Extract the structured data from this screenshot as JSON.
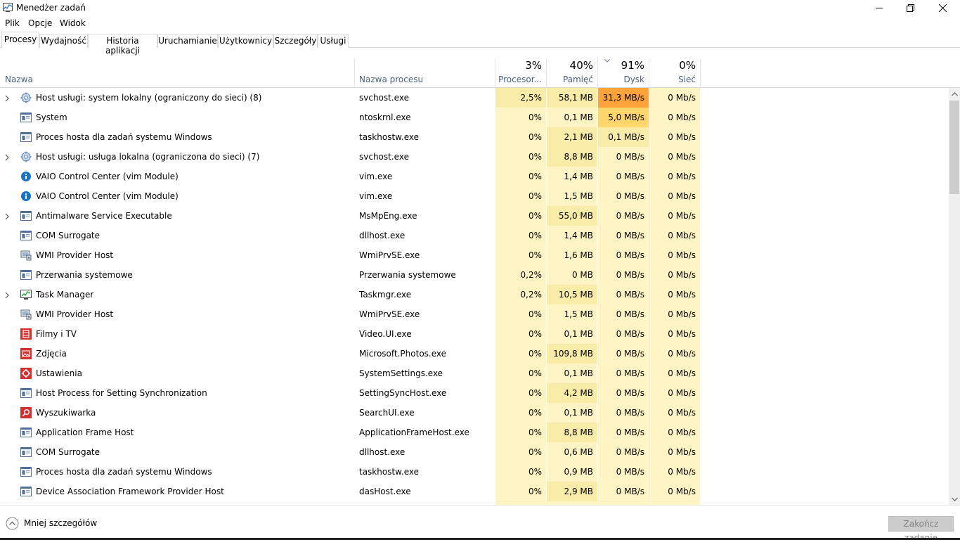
{
  "window": {
    "title": "Menedżer zadań"
  },
  "menu": [
    "Plik",
    "Opcje",
    "Widok"
  ],
  "tabs": [
    "Procesy",
    "Wydajność",
    "Historia aplikacji",
    "Uruchamianie",
    "Użytkownicy",
    "Szczegóły",
    "Usługi"
  ],
  "active_tab": "Procesy",
  "columns": {
    "name": "Nazwa",
    "process": "Nazwa procesu",
    "cpu": {
      "label": "Procesor...",
      "total": "3%"
    },
    "memory": {
      "label": "Pamięć",
      "total": "40%"
    },
    "disk": {
      "label": "Dysk",
      "total": "91%"
    },
    "network": {
      "label": "Sieć",
      "total": "0%"
    }
  },
  "processes": [
    {
      "name": "Host usługi: system lokalny (ograniczony do sieci) (8)",
      "process": "svchost.exe",
      "cpu": "2,5%",
      "mem": "58,1 MB",
      "disk": "31,3 MB/s",
      "net": "0 Mb/s",
      "icon": "gear-icon",
      "expandable": true
    },
    {
      "name": "System",
      "process": "ntoskrnl.exe",
      "cpu": "0%",
      "mem": "0,1 MB",
      "disk": "5,0 MB/s",
      "net": "0 Mb/s",
      "icon": "window-icon",
      "expandable": false
    },
    {
      "name": "Proces hosta dla zadań systemu Windows",
      "process": "taskhostw.exe",
      "cpu": "0%",
      "mem": "2,1 MB",
      "disk": "0,1 MB/s",
      "net": "0 Mb/s",
      "icon": "window-icon",
      "expandable": false
    },
    {
      "name": "Host usługi: usługa lokalna (ograniczona do sieci) (7)",
      "process": "svchost.exe",
      "cpu": "0%",
      "mem": "8,8 MB",
      "disk": "0 MB/s",
      "net": "0 Mb/s",
      "icon": "gear-icon",
      "expandable": true
    },
    {
      "name": "VAIO Control Center (vim Module)",
      "process": "vim.exe",
      "cpu": "0%",
      "mem": "1,4 MB",
      "disk": "0 MB/s",
      "net": "0 Mb/s",
      "icon": "info-icon",
      "expandable": false
    },
    {
      "name": "VAIO Control Center (vim Module)",
      "process": "vim.exe",
      "cpu": "0%",
      "mem": "1,5 MB",
      "disk": "0 MB/s",
      "net": "0 Mb/s",
      "icon": "info-icon",
      "expandable": false
    },
    {
      "name": "Antimalware Service Executable",
      "process": "MsMpEng.exe",
      "cpu": "0%",
      "mem": "55,0 MB",
      "disk": "0 MB/s",
      "net": "0 Mb/s",
      "icon": "window-icon",
      "expandable": true
    },
    {
      "name": "COM Surrogate",
      "process": "dllhost.exe",
      "cpu": "0%",
      "mem": "1,4 MB",
      "disk": "0 MB/s",
      "net": "0 Mb/s",
      "icon": "window-icon",
      "expandable": false
    },
    {
      "name": "WMI Provider Host",
      "process": "WmiPrvSE.exe",
      "cpu": "0%",
      "mem": "1,6 MB",
      "disk": "0 MB/s",
      "net": "0 Mb/s",
      "icon": "wmi-icon",
      "expandable": false
    },
    {
      "name": "Przerwania systemowe",
      "process": "Przerwania systemowe",
      "cpu": "0,2%",
      "mem": "0 MB",
      "disk": "0 MB/s",
      "net": "0 Mb/s",
      "icon": "window-icon",
      "expandable": false
    },
    {
      "name": "Task Manager",
      "process": "Taskmgr.exe",
      "cpu": "0,2%",
      "mem": "10,5 MB",
      "disk": "0 MB/s",
      "net": "0 Mb/s",
      "icon": "task-manager-icon",
      "expandable": true
    },
    {
      "name": "WMI Provider Host",
      "process": "WmiPrvSE.exe",
      "cpu": "0%",
      "mem": "1,5 MB",
      "disk": "0 MB/s",
      "net": "0 Mb/s",
      "icon": "wmi-icon",
      "expandable": false
    },
    {
      "name": "Filmy i TV",
      "process": "Video.UI.exe",
      "cpu": "0%",
      "mem": "0,1 MB",
      "disk": "0 MB/s",
      "net": "0 Mb/s",
      "icon": "film-icon",
      "expandable": false
    },
    {
      "name": "Zdjęcia",
      "process": "Microsoft.Photos.exe",
      "cpu": "0%",
      "mem": "109,8 MB",
      "disk": "0 MB/s",
      "net": "0 Mb/s",
      "icon": "photo-icon",
      "expandable": false
    },
    {
      "name": "Ustawienia",
      "process": "SystemSettings.exe",
      "cpu": "0%",
      "mem": "0,1 MB",
      "disk": "0 MB/s",
      "net": "0 Mb/s",
      "icon": "settings-icon",
      "expandable": false
    },
    {
      "name": "Host Process for Setting Synchronization",
      "process": "SettingSyncHost.exe",
      "cpu": "0%",
      "mem": "4,2 MB",
      "disk": "0 MB/s",
      "net": "0 Mb/s",
      "icon": "window-icon",
      "expandable": false
    },
    {
      "name": "Wyszukiwarka",
      "process": "SearchUI.exe",
      "cpu": "0%",
      "mem": "0,1 MB",
      "disk": "0 MB/s",
      "net": "0 Mb/s",
      "icon": "search-icon",
      "expandable": false
    },
    {
      "name": "Application Frame Host",
      "process": "ApplicationFrameHost.exe",
      "cpu": "0%",
      "mem": "8,8 MB",
      "disk": "0 MB/s",
      "net": "0 Mb/s",
      "icon": "window-icon",
      "expandable": false
    },
    {
      "name": "COM Surrogate",
      "process": "dllhost.exe",
      "cpu": "0%",
      "mem": "0,6 MB",
      "disk": "0 MB/s",
      "net": "0 Mb/s",
      "icon": "window-icon",
      "expandable": false
    },
    {
      "name": "Proces hosta dla zadań systemu Windows",
      "process": "taskhostw.exe",
      "cpu": "0%",
      "mem": "0,9 MB",
      "disk": "0 MB/s",
      "net": "0 Mb/s",
      "icon": "window-icon",
      "expandable": false
    },
    {
      "name": "Device Association Framework Provider Host",
      "process": "dasHost.exe",
      "cpu": "0%",
      "mem": "2,9 MB",
      "disk": "0 MB/s",
      "net": "0 Mb/s",
      "icon": "window-icon",
      "expandable": false
    }
  ],
  "footer": {
    "less_details": "Mniej szczegółów",
    "end_task": "Zakończ zadanie"
  },
  "colors": {
    "heat_base": "#fff4c4",
    "heat_low": "#f9eca8",
    "heat_med": "#ffd66a",
    "heat_high": "#ffa33a",
    "header_label": "#4c607a"
  }
}
